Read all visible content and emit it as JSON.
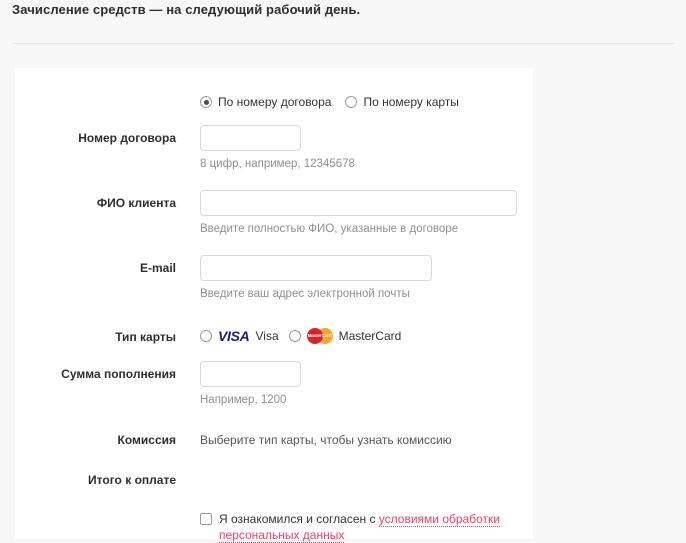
{
  "header": {
    "title": "Зачисление средств — на следующий рабочий день."
  },
  "form": {
    "lookup_mode": {
      "options": [
        {
          "label": "По номеру договора",
          "selected": true
        },
        {
          "label": "По номеру карты",
          "selected": false
        }
      ]
    },
    "fields": {
      "contract_number": {
        "label": "Номер договора",
        "value": "",
        "placeholder": "",
        "hint": "8 цифр, например, 12345678"
      },
      "client_name": {
        "label": "ФИО клиента",
        "value": "",
        "placeholder": "",
        "hint": "Введите полностью ФИО, указанные в договоре"
      },
      "email": {
        "label": "E-mail",
        "value": "",
        "placeholder": "",
        "hint": "Введите ваш адрес электронной почты"
      },
      "card_type": {
        "label": "Тип карты",
        "options": [
          {
            "label": "Visa",
            "logo": "visa-logo",
            "logo_text": "VISA",
            "selected": false
          },
          {
            "label": "MasterCard",
            "logo": "mastercard-logo",
            "logo_text": "MasterCard",
            "selected": false
          }
        ]
      },
      "amount": {
        "label": "Сумма пополнения",
        "value": "",
        "placeholder": "",
        "hint": "Например, 1200"
      },
      "commission": {
        "label": "Комиссия",
        "value": "Выберите тип карты, чтобы узнать комиссию"
      },
      "total": {
        "label": "Итого к оплате",
        "value": ""
      }
    },
    "consent": {
      "checked": false,
      "text_before": "Я ознакомился и согласен с ",
      "link_text": "условиями обработки персональных данных"
    }
  },
  "colors": {
    "page_background": "#f7f7f7",
    "card_background": "#ffffff",
    "label_text": "#2e2e2e",
    "hint_text": "#8f8f8f",
    "link_accent": "#e8416a",
    "visa_blue": "#1a1f71",
    "mastercard_red": "#d8232a",
    "mastercard_orange": "#f79e1b",
    "input_border": "#d8d8d8",
    "divider": "#e2e2e2"
  }
}
